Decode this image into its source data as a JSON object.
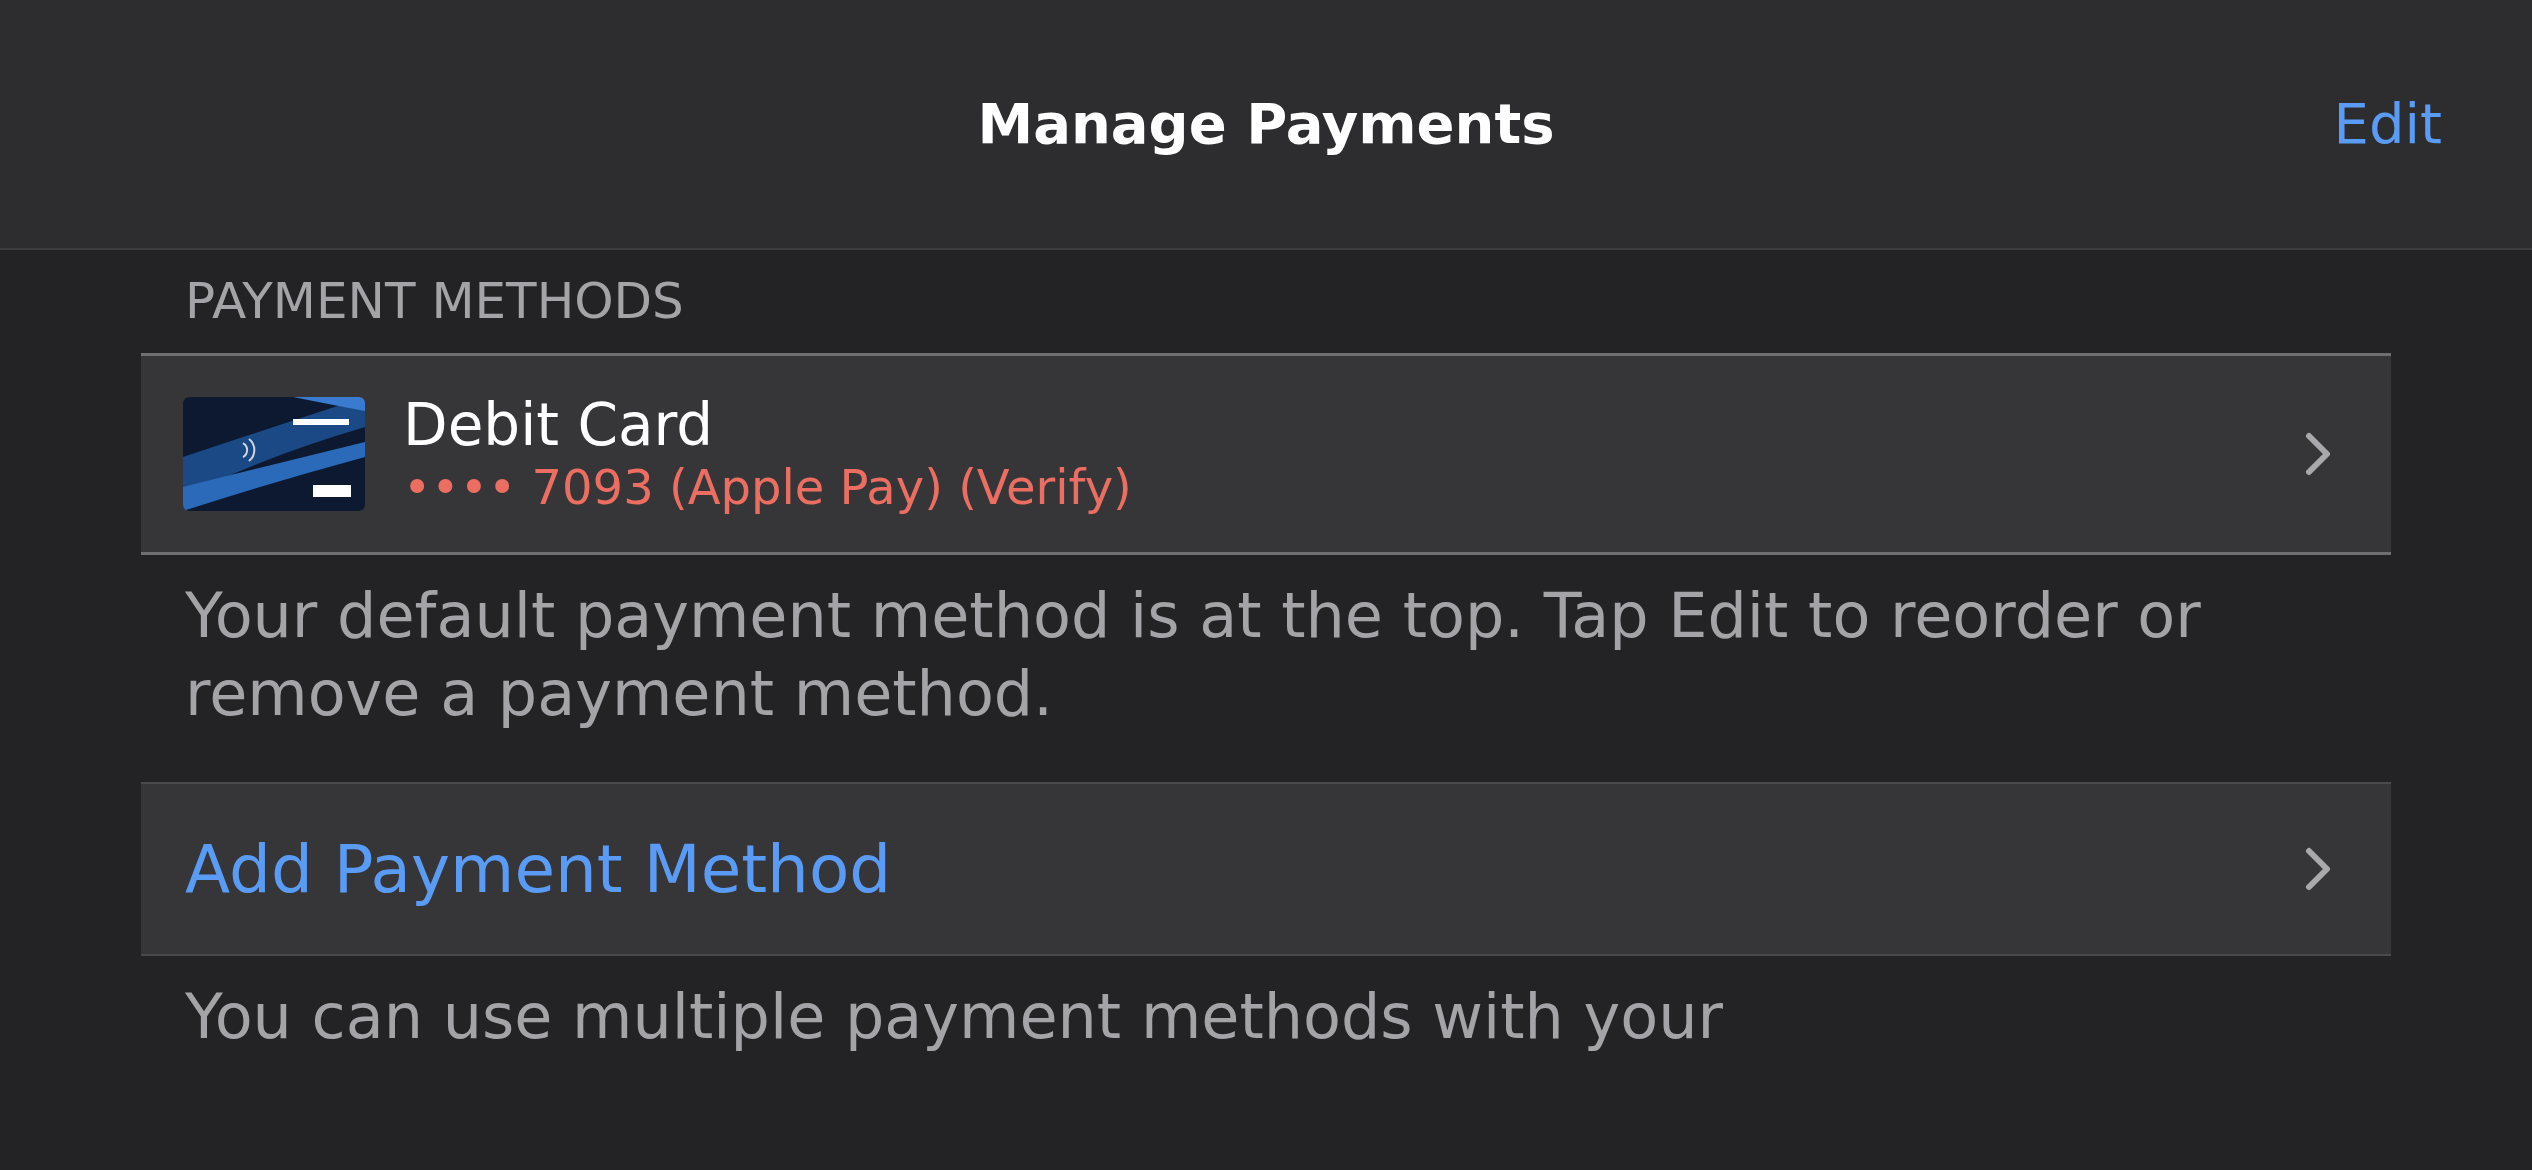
{
  "nav": {
    "title": "Manage Payments",
    "edit": "Edit"
  },
  "section_header": "PAYMENT METHODS",
  "payment_methods": [
    {
      "kind": "card",
      "title": "Debit Card",
      "subtitle": "•••• 7093 (Apple Pay) (Verify)",
      "warning": true
    }
  ],
  "footer": "Your default payment method is at the top. Tap Edit to reorder or remove a payment method.",
  "actions": [
    {
      "label": "Add Payment Method"
    }
  ],
  "bottom_note": "You can use multiple payment methods with your"
}
